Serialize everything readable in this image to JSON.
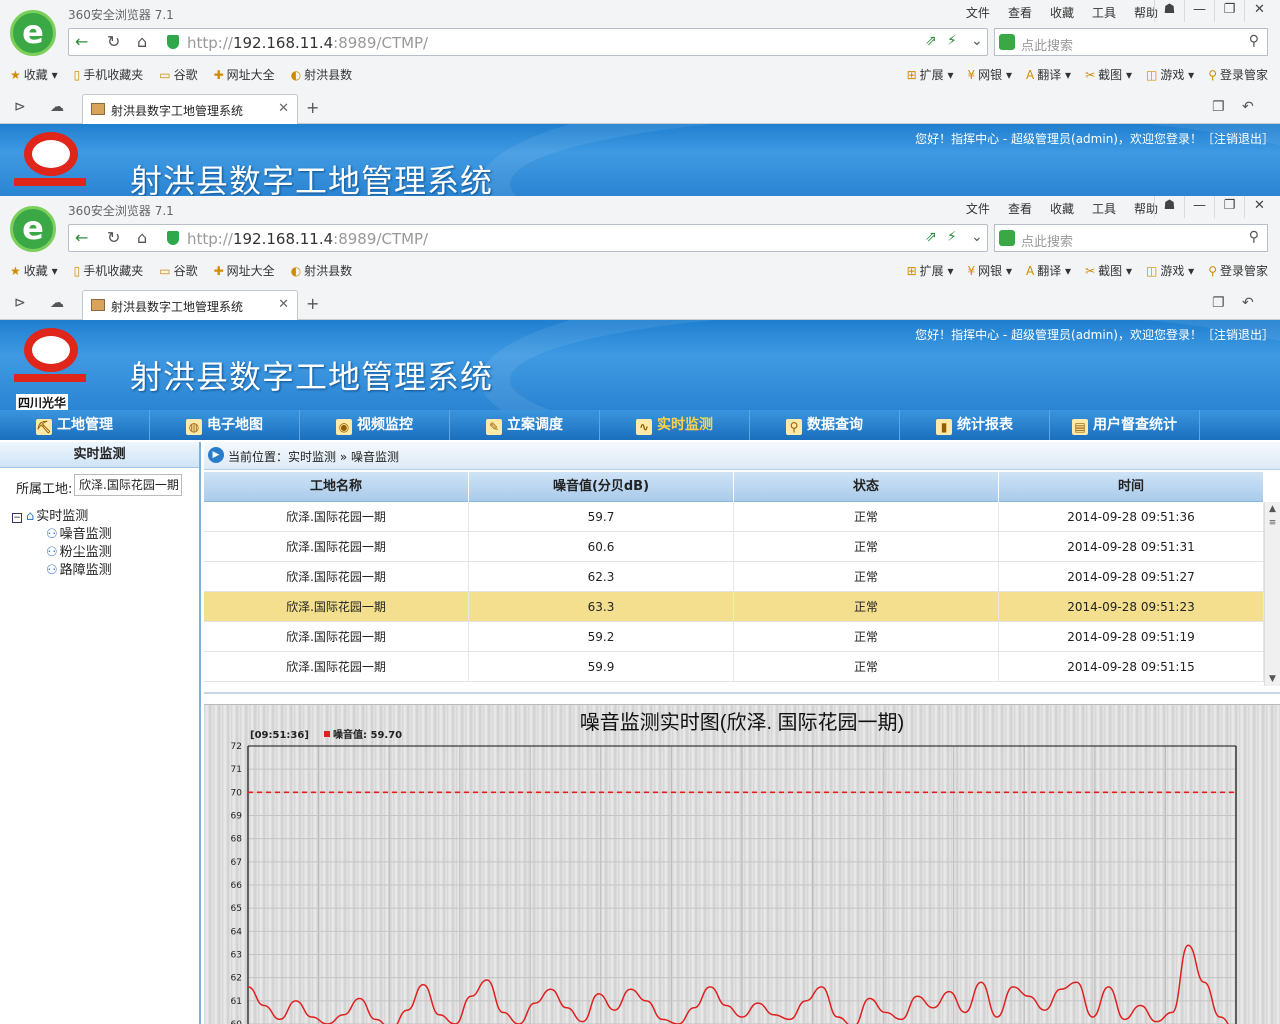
{
  "browser": {
    "title": "360安全浏览器 7.1",
    "menu": [
      "文件",
      "查看",
      "收藏",
      "工具",
      "帮助"
    ],
    "url_host": "192.168.11.4",
    "url_rest": ":8989/CTMP/",
    "url_scheme": "http://",
    "search_placeholder": "点此搜索",
    "favorites": [
      "收藏",
      "手机收藏夹",
      "谷歌",
      "网址大全",
      "射洪县数"
    ],
    "tools": [
      "扩展",
      "网银",
      "翻译",
      "截图",
      "游戏",
      "登录管家"
    ],
    "tab_title": "射洪县数字工地管理系统"
  },
  "app": {
    "logo_caption": "四川光华",
    "title": "射洪县数字工地管理系统",
    "welcome": "您好！指挥中心 - 超级管理员(admin)，欢迎您登录！［注销退出］"
  },
  "nav": [
    {
      "label": "工地管理",
      "icon": "crane-icon",
      "glyph": "⛏",
      "active": false
    },
    {
      "label": "电子地图",
      "icon": "globe-icon",
      "glyph": "◍",
      "active": false
    },
    {
      "label": "视频监控",
      "icon": "camera-icon",
      "glyph": "◉",
      "active": false
    },
    {
      "label": "立案调度",
      "icon": "note-icon",
      "glyph": "✎",
      "active": false
    },
    {
      "label": "实时监测",
      "icon": "monitor-icon",
      "glyph": "∿",
      "active": true
    },
    {
      "label": "数据查询",
      "icon": "query-icon",
      "glyph": "⚲",
      "active": false
    },
    {
      "label": "统计报表",
      "icon": "bar-chart-icon",
      "glyph": "▮",
      "active": false
    },
    {
      "label": "用户督查统计",
      "icon": "user-report-icon",
      "glyph": "▤",
      "active": false
    }
  ],
  "sidebar": {
    "header": "实时监测",
    "site_label": "所属工地:",
    "site_value": "欣泽.国际花园一期",
    "tree_root": "实时监测",
    "tree_items": [
      "噪音监测",
      "粉尘监测",
      "路障监测"
    ]
  },
  "breadcrumb": "当前位置：实时监测 » 噪音监测",
  "table": {
    "columns": [
      "工地名称",
      "噪音值(分贝dB)",
      "状态",
      "时间"
    ],
    "highlight_row": 3,
    "rows": [
      [
        "欣泽.国际花园一期",
        "59.7",
        "正常",
        "2014-09-28 09:51:36"
      ],
      [
        "欣泽.国际花园一期",
        "60.6",
        "正常",
        "2014-09-28 09:51:31"
      ],
      [
        "欣泽.国际花园一期",
        "62.3",
        "正常",
        "2014-09-28 09:51:27"
      ],
      [
        "欣泽.国际花园一期",
        "63.3",
        "正常",
        "2014-09-28 09:51:23"
      ],
      [
        "欣泽.国际花园一期",
        "59.2",
        "正常",
        "2014-09-28 09:51:19"
      ],
      [
        "欣泽.国际花园一期",
        "59.9",
        "正常",
        "2014-09-28 09:51:15"
      ]
    ]
  },
  "chart_data": {
    "type": "line",
    "title": "噪音监测实时图(欣泽. 国际花园一期)",
    "tooltip_time": "[09:51:36]",
    "legend": "噪音值: 59.70",
    "series_color": "#e02020",
    "threshold": 70,
    "ylim": [
      60,
      72
    ],
    "yticks": [
      60,
      61,
      62,
      63,
      64,
      65,
      66,
      67,
      68,
      69,
      70,
      71,
      72
    ],
    "values": [
      61.6,
      60.8,
      60.2,
      61.0,
      60.3,
      60.0,
      60.4,
      61.1,
      60.2,
      59.8,
      60.6,
      61.7,
      60.4,
      60.0,
      61.2,
      61.9,
      60.5,
      60.0,
      60.9,
      61.5,
      60.7,
      60.1,
      61.3,
      60.6,
      61.5,
      61.0,
      60.2,
      60.0,
      60.7,
      61.6,
      60.8,
      60.3,
      60.9,
      60.4,
      60.2,
      61.0,
      61.6,
      60.3,
      59.9,
      61.1,
      60.5,
      60.2,
      61.2,
      60.7,
      61.4,
      60.5,
      61.8,
      60.3,
      61.6,
      61.2,
      60.6,
      61.5,
      61.8,
      60.3,
      61.6,
      60.2,
      60.8,
      60.1,
      60.5,
      63.4,
      61.8,
      60.3,
      59.7
    ]
  }
}
